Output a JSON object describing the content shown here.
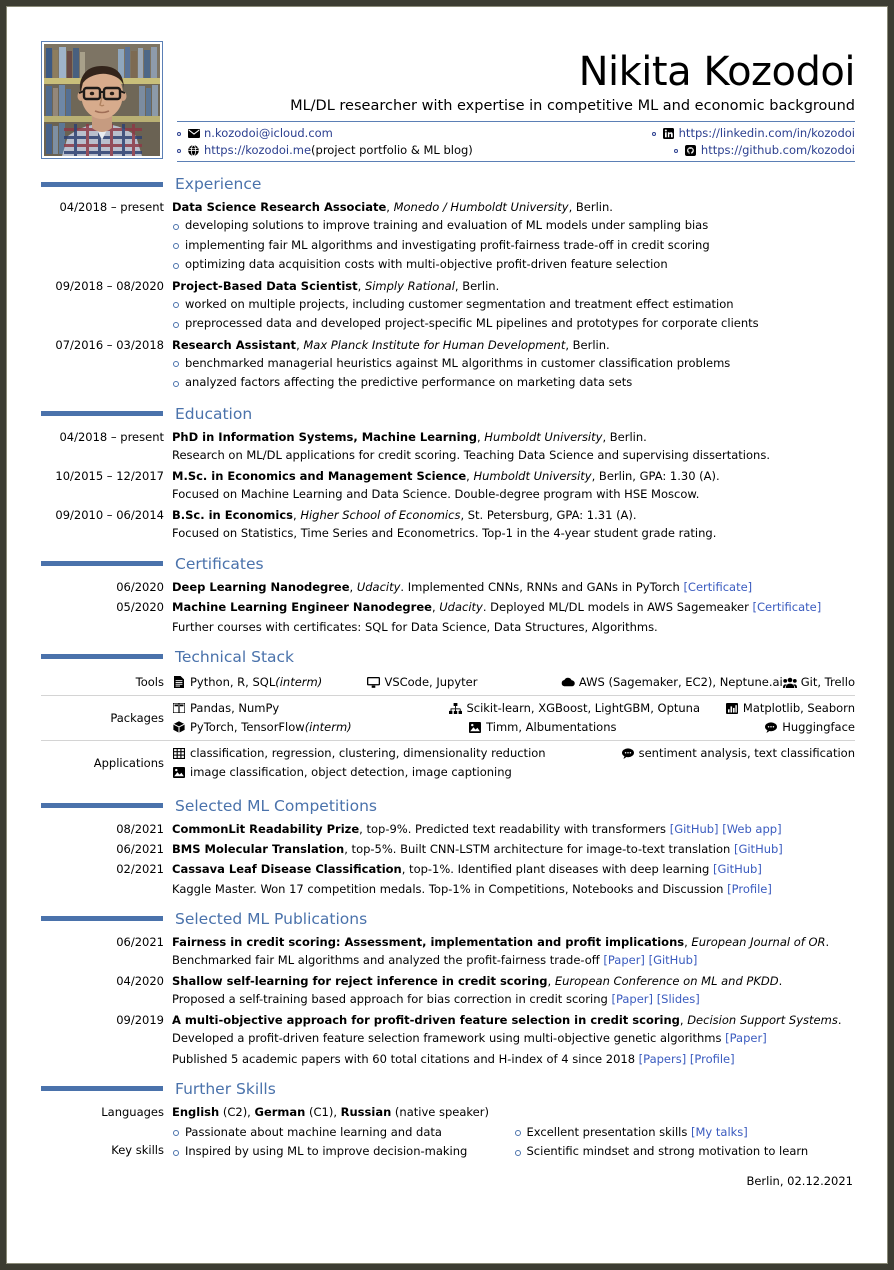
{
  "header": {
    "name": "Nikita Kozodoi",
    "tagline": "ML/DL researcher with expertise in competitive ML and economic background",
    "contacts": [
      {
        "icon": "envelope-icon",
        "text": "n.kozodoi@icloud.com",
        "note": ""
      },
      {
        "icon": "linkedin-icon",
        "text": "https://linkedin.com/in/kozodoi",
        "note": ""
      },
      {
        "icon": "globe-icon",
        "text": "https://kozodoi.me",
        "note": " (project portfolio & ML blog)"
      },
      {
        "icon": "github-icon",
        "text": "https://github.com/kozodoi",
        "note": ""
      }
    ]
  },
  "sections": {
    "experience": {
      "title": "Experience",
      "entries": [
        {
          "date": "04/2018 – present",
          "role": "Data Science Research Associate",
          "org": "Monedo / Humboldt University",
          "location": ", Berlin.",
          "bullets": [
            "developing solutions to improve training and evaluation of ML models under sampling bias",
            "implementing fair ML algorithms and investigating profit-fairness trade-off in credit scoring",
            "optimizing data acquisition costs with multi-objective profit-driven feature selection"
          ]
        },
        {
          "date": "09/2018 – 08/2020",
          "role": "Project-Based Data Scientist",
          "org": "Simply Rational",
          "location": ", Berlin.",
          "bullets": [
            "worked on multiple projects, including customer segmentation and treatment effect estimation",
            "preprocessed data and developed project-specific ML pipelines and prototypes for corporate clients"
          ]
        },
        {
          "date": "07/2016 – 03/2018",
          "role": "Research Assistant",
          "org": "Max Planck Institute for Human Development",
          "location": ", Berlin.",
          "bullets": [
            "benchmarked managerial heuristics against ML algorithms in customer classification problems",
            "analyzed factors affecting the predictive performance on marketing data sets"
          ]
        }
      ]
    },
    "education": {
      "title": "Education",
      "entries": [
        {
          "date": "04/2018 – present",
          "degree": "PhD in Information Systems, Machine Learning",
          "org": "Humboldt University",
          "location": ", Berlin.",
          "detail": "Research on ML/DL applications for credit scoring. Teaching Data Science and supervising dissertations."
        },
        {
          "date": "10/2015 – 12/2017",
          "degree": "M.Sc. in Economics and Management Science",
          "org": "Humboldt University",
          "location": ", Berlin, GPA: 1.30 (A).",
          "detail": "Focused on Machine Learning and Data Science. Double-degree program with HSE Moscow."
        },
        {
          "date": "09/2010 – 06/2014",
          "degree": "B.Sc. in Economics",
          "org": "Higher School of Economics",
          "location": ", St. Petersburg, GPA: 1.31 (A).",
          "detail": "Focused on Statistics, Time Series and Econometrics. Top-1 in the 4-year student grade rating."
        }
      ]
    },
    "certificates": {
      "title": "Certificates",
      "entries": [
        {
          "date": "06/2020",
          "name": "Deep Learning Nanodegree",
          "org": "Udacity",
          "detail": ". Implemented CNNs, RNNs and GANs in PyTorch ",
          "links": [
            "[Certificate]"
          ]
        },
        {
          "date": "05/2020",
          "name": "Machine Learning Engineer Nanodegree",
          "org": "Udacity",
          "detail": ". Deployed ML/DL models in AWS Sagemeaker ",
          "links": [
            "[Certificate]"
          ]
        }
      ],
      "footnote": "Further courses with certificates: SQL for Data Science, Data Structures, Algorithms."
    },
    "tech_stack": {
      "title": "Technical Stack",
      "rows": [
        {
          "label": "Tools",
          "lines": [
            [
              {
                "icon": "file-code-icon",
                "text": "Python, R, SQL ",
                "em": "(interm)"
              },
              {
                "icon": "monitor-icon",
                "text": "VSCode, Jupyter",
                "em": ""
              },
              {
                "icon": "cloud-icon",
                "text": "AWS (Sagemaker, EC2), Neptune.ai",
                "em": ""
              },
              {
                "icon": "users-icon",
                "text": "Git, Trello",
                "em": ""
              }
            ]
          ]
        },
        {
          "label": "Packages",
          "lines": [
            [
              {
                "icon": "columns-icon",
                "text": "Pandas, NumPy",
                "em": ""
              },
              {
                "icon": "sitemap-icon",
                "text": "Scikit-learn, XGBoost, LightGBM, Optuna",
                "em": ""
              },
              {
                "icon": "chart-bar-icon",
                "text": "Matplotlib, Seaborn",
                "em": ""
              }
            ],
            [
              {
                "icon": "cube-icon",
                "text": "PyTorch, TensorFlow ",
                "em": "(interm)"
              },
              {
                "icon": "image-icon",
                "text": "Timm, Albumentations",
                "em": ""
              },
              {
                "icon": "comment-icon",
                "text": "Huggingface",
                "em": ""
              }
            ]
          ]
        },
        {
          "label": "Applications",
          "lines": [
            [
              {
                "icon": "table-icon",
                "text": "classification, regression, clustering, dimensionality reduction",
                "em": ""
              },
              {
                "icon": "comment-icon",
                "text": "sentiment analysis, text classification",
                "em": ""
              }
            ],
            [
              {
                "icon": "image-icon",
                "text": "image classification, object detection, image captioning",
                "em": ""
              }
            ]
          ]
        }
      ]
    },
    "competitions": {
      "title": "Selected ML Competitions",
      "entries": [
        {
          "date": "08/2021",
          "name": "CommonLit Readability Prize",
          "detail": ", top-9%. Predicted text readability with transformers ",
          "links": [
            "[GitHub]",
            "[Web app]"
          ]
        },
        {
          "date": "06/2021",
          "name": "BMS Molecular Translation",
          "detail": ", top-5%. Built CNN-LSTM architecture for image-to-text translation ",
          "links": [
            "[GitHub]"
          ]
        },
        {
          "date": "02/2021",
          "name": "Cassava Leaf Disease Classification",
          "detail": ", top-1%. Identified plant diseases with deep learning ",
          "links": [
            "[GitHub]"
          ]
        }
      ],
      "footnote": "Kaggle Master. Won 17 competition medals. Top-1% in Competitions, Notebooks and Discussion ",
      "footnote_links": [
        "[Profile]"
      ]
    },
    "publications": {
      "title": "Selected ML Publications",
      "entries": [
        {
          "date": "06/2021",
          "name": "Fairness in credit scoring: Assessment, implementation and profit implications",
          "venue": "European Journal of OR",
          "venue_suffix": ".",
          "detail": "Benchmarked fair ML algorithms and analyzed the profit-fairness trade-off ",
          "links": [
            "[Paper]",
            "[GitHub]"
          ]
        },
        {
          "date": "04/2020",
          "name": "Shallow self-learning for reject inference in credit scoring",
          "venue": "European Conference on ML and PKDD",
          "venue_suffix": ".",
          "detail": "Proposed a self-training based approach for bias correction in credit scoring ",
          "links": [
            "[Paper]",
            "[Slides]"
          ]
        },
        {
          "date": "09/2019",
          "name": "A multi-objective approach for profit-driven feature selection in credit scoring",
          "venue": "Decision Support Systems",
          "venue_suffix": ".",
          "detail": "Developed a profit-driven feature selection framework using multi-objective genetic algorithms ",
          "links": [
            "[Paper]"
          ]
        }
      ],
      "footnote": "Published 5 academic papers with 60 total citations and H-index of 4 since 2018 ",
      "footnote_links": [
        "[Papers]",
        "[Profile]"
      ]
    },
    "further_skills": {
      "title": "Further Skills",
      "languages_label": "Languages",
      "languages": [
        {
          "name": "English",
          "level": " (C2), "
        },
        {
          "name": "German",
          "level": " (C1), "
        },
        {
          "name": "Russian",
          "level": " (native speaker)"
        }
      ],
      "key_skills_label": "Key skills",
      "key_skills_left": [
        {
          "text": "Passionate about machine learning and data",
          "link": ""
        },
        {
          "text": "Inspired by using ML to improve decision-making",
          "link": ""
        }
      ],
      "key_skills_right": [
        {
          "text": "Excellent presentation skills ",
          "link": "[My talks]"
        },
        {
          "text": "Scientific mindset and strong motivation to learn",
          "link": ""
        }
      ]
    }
  },
  "footer": "Berlin, 02.12.2021"
}
